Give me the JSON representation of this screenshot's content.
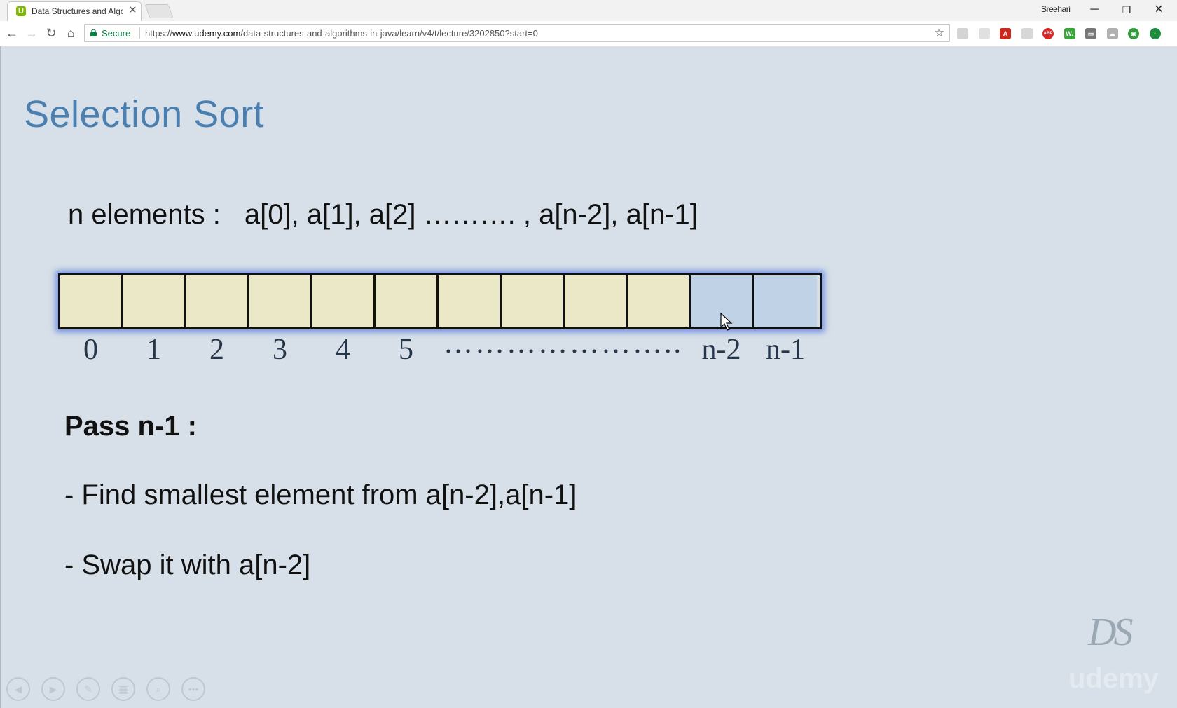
{
  "browser": {
    "tab_title": "Data Structures and Algo",
    "tab_favicon_letter": "U",
    "tab_close": "✕",
    "profile_name": "Sreehari",
    "window_controls": {
      "minimize": "─",
      "restore": "❐",
      "close": "✕"
    },
    "nav": {
      "back": "←",
      "forward": "→",
      "reload": "↻",
      "home": "⌂"
    },
    "secure_label": "Secure",
    "url_scheme": "https://",
    "url_host": "www.udemy.com",
    "url_path": "/data-structures-and-algorithms-in-java/learn/v4/t/lecture/3202850?start=0",
    "bookmark_star": "☆",
    "extensions": [
      {
        "name": "ext-generic-1",
        "glyph": "",
        "color": "#b8b8b8"
      },
      {
        "name": "ext-generic-2",
        "glyph": "",
        "color": "#cccccc"
      },
      {
        "name": "ext-acrobat",
        "glyph": "A",
        "color": "#c8281e"
      },
      {
        "name": "ext-generic-3",
        "glyph": "",
        "color": "#bdbdbd"
      },
      {
        "name": "ext-adblock",
        "glyph": "ABP",
        "color": "#d82a2a"
      },
      {
        "name": "ext-w",
        "glyph": "W.",
        "color": "#3aa63a"
      },
      {
        "name": "ext-cast",
        "glyph": "▭",
        "color": "#777777"
      },
      {
        "name": "ext-cloud",
        "glyph": "☁",
        "color": "#b0b0b0"
      },
      {
        "name": "ext-audio",
        "glyph": "◉",
        "color": "#2e9e3a"
      },
      {
        "name": "ext-update",
        "glyph": "↑",
        "color": "#1e8e3e"
      }
    ]
  },
  "slide": {
    "title": "Selection Sort",
    "elements_label": "n elements :",
    "elements_list": "a[0], a[1], a[2] ………. , a[n-2], a[n-1]",
    "cells": [
      {
        "label": "0",
        "highlight": false
      },
      {
        "label": "1",
        "highlight": false
      },
      {
        "label": "2",
        "highlight": false
      },
      {
        "label": "3",
        "highlight": false
      },
      {
        "label": "4",
        "highlight": false
      },
      {
        "label": "5",
        "highlight": false
      },
      {
        "label": "",
        "highlight": false
      },
      {
        "label": "",
        "highlight": false
      },
      {
        "label": "",
        "highlight": false
      },
      {
        "label": "",
        "highlight": false
      },
      {
        "label": "n-2",
        "highlight": true
      },
      {
        "label": "n-1",
        "highlight": true
      }
    ],
    "index_dots": "…………………..",
    "pass_heading": "Pass n-1 :",
    "bullet_1": "- Find smallest element from a[n-2],a[n-1]",
    "bullet_2": "- Swap it with a[n-2]",
    "watermark_logo": "DS",
    "watermark_brand": "udemy"
  },
  "player_controls": [
    {
      "name": "previous-slide-button",
      "glyph": "◀"
    },
    {
      "name": "next-slide-button",
      "glyph": "▶"
    },
    {
      "name": "pen-tool-button",
      "glyph": "✎"
    },
    {
      "name": "slides-overview-button",
      "glyph": "▦"
    },
    {
      "name": "zoom-button",
      "glyph": "⌕"
    },
    {
      "name": "more-options-button",
      "glyph": "•••"
    }
  ]
}
